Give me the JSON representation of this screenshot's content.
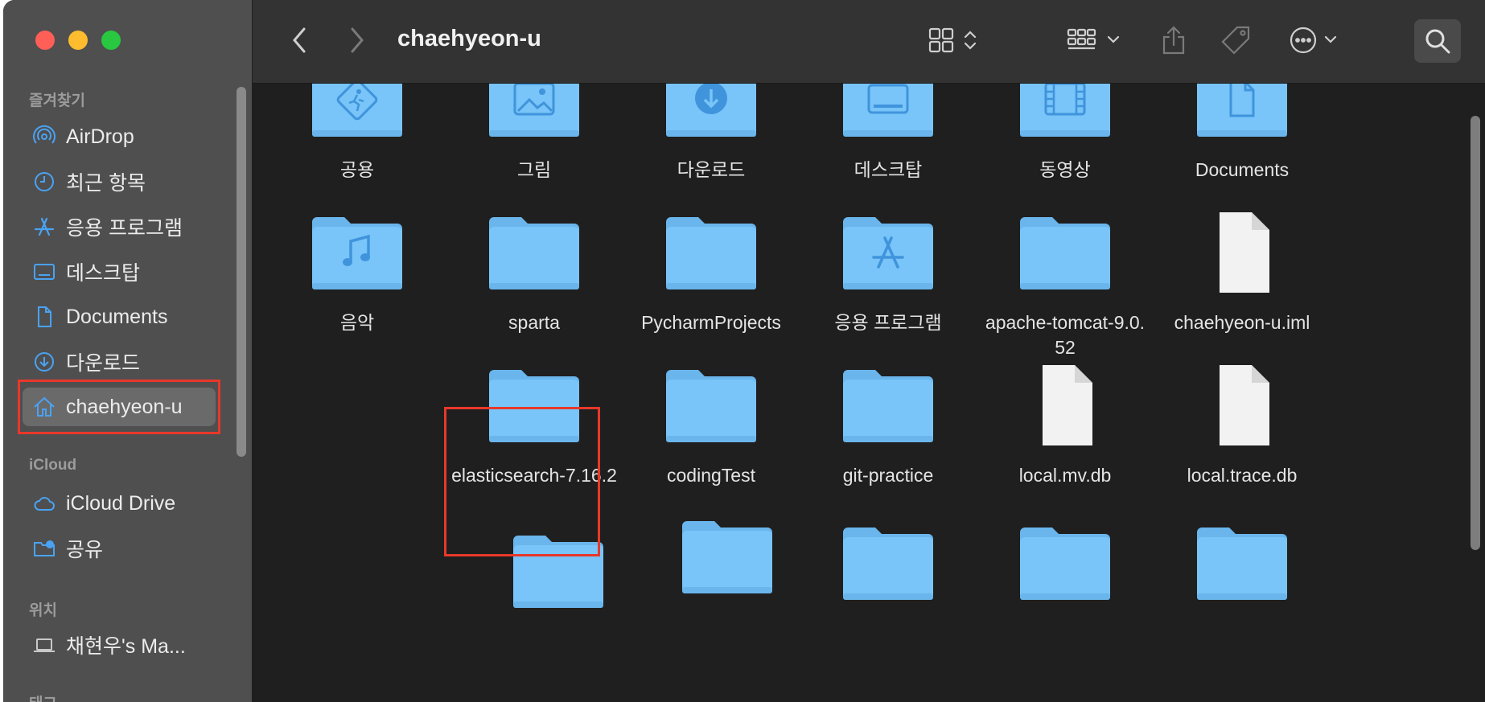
{
  "window": {
    "title": "chaehyeon-u"
  },
  "sidebar": {
    "sections": [
      {
        "label": "즐겨찾기"
      },
      {
        "label": "iCloud"
      },
      {
        "label": "위치"
      },
      {
        "label": "태그"
      }
    ],
    "favorites": [
      {
        "label": "AirDrop",
        "icon": "airdrop-icon"
      },
      {
        "label": "최근 항목",
        "icon": "clock-icon"
      },
      {
        "label": "응용 프로그램",
        "icon": "apps-icon"
      },
      {
        "label": "데스크탑",
        "icon": "desktop-icon"
      },
      {
        "label": "Documents",
        "icon": "document-icon"
      },
      {
        "label": "다운로드",
        "icon": "download-icon"
      },
      {
        "label": "chaehyeon-u",
        "icon": "home-icon"
      }
    ],
    "icloud": [
      {
        "label": "iCloud Drive",
        "icon": "cloud-icon"
      },
      {
        "label": "공유",
        "icon": "shared-folder-icon"
      }
    ],
    "locations": [
      {
        "label": "채현우's Ma...",
        "icon": "laptop-icon"
      }
    ]
  },
  "files": [
    {
      "label": "공용",
      "kind": "folder",
      "glyph": "public"
    },
    {
      "label": "그림",
      "kind": "folder",
      "glyph": "picture"
    },
    {
      "label": "다운로드",
      "kind": "folder",
      "glyph": "download"
    },
    {
      "label": "데스크탑",
      "kind": "folder",
      "glyph": "desktop"
    },
    {
      "label": "동영상",
      "kind": "folder",
      "glyph": "film"
    },
    {
      "label": "Documents",
      "kind": "folder",
      "glyph": "document"
    },
    {
      "label": "음악",
      "kind": "folder",
      "glyph": "music"
    },
    {
      "label": "sparta",
      "kind": "folder",
      "glyph": ""
    },
    {
      "label": "PycharmProjects",
      "kind": "folder",
      "glyph": ""
    },
    {
      "label": "응용 프로그램",
      "kind": "folder",
      "glyph": "apps"
    },
    {
      "label": "apache-tomcat-9.0.52",
      "kind": "folder",
      "glyph": ""
    },
    {
      "label": "chaehyeon-u.iml",
      "kind": "file",
      "glyph": ""
    },
    {
      "label": "elasticsearch-7.16.2",
      "kind": "folder",
      "glyph": ""
    },
    {
      "label": "codingTest",
      "kind": "folder",
      "glyph": ""
    },
    {
      "label": "git-practice",
      "kind": "folder",
      "glyph": ""
    },
    {
      "label": "local.mv.db",
      "kind": "file",
      "glyph": ""
    },
    {
      "label": "local.trace.db",
      "kind": "file",
      "glyph": ""
    }
  ],
  "colors": {
    "folder": "#79c4f8",
    "folder_tab": "#69b5ec",
    "highlight": "#e8382a",
    "accent": "#4aa3f2"
  }
}
